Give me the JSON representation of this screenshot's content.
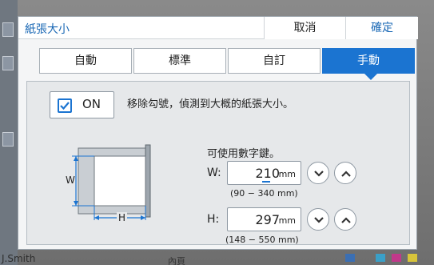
{
  "background": {
    "user_name": "J.Smith",
    "group_label": "內頁"
  },
  "dialog": {
    "title": "紙張大小",
    "cancel_label": "取消",
    "confirm_label": "確定"
  },
  "tabs": [
    {
      "label": "自動",
      "active": false
    },
    {
      "label": "標準",
      "active": false
    },
    {
      "label": "自訂",
      "active": false
    },
    {
      "label": "手動",
      "active": true
    }
  ],
  "panel": {
    "on_toggle": {
      "label": "ON",
      "checked": true
    },
    "instruction": "移除勾號，偵測到大概的紙張大小。",
    "numkey_hint": "可使用數字鍵。",
    "width": {
      "label": "W:",
      "value": "210",
      "unit": "mm",
      "range": "(90 − 340 mm)"
    },
    "height": {
      "label": "H:",
      "value": "297",
      "unit": "mm",
      "range": "(148 − 550 mm)"
    },
    "diagram": {
      "w_label": "W",
      "h_label": "H"
    }
  },
  "colors": {
    "accent": "#1b74d1",
    "title_text": "#1a68b5"
  }
}
